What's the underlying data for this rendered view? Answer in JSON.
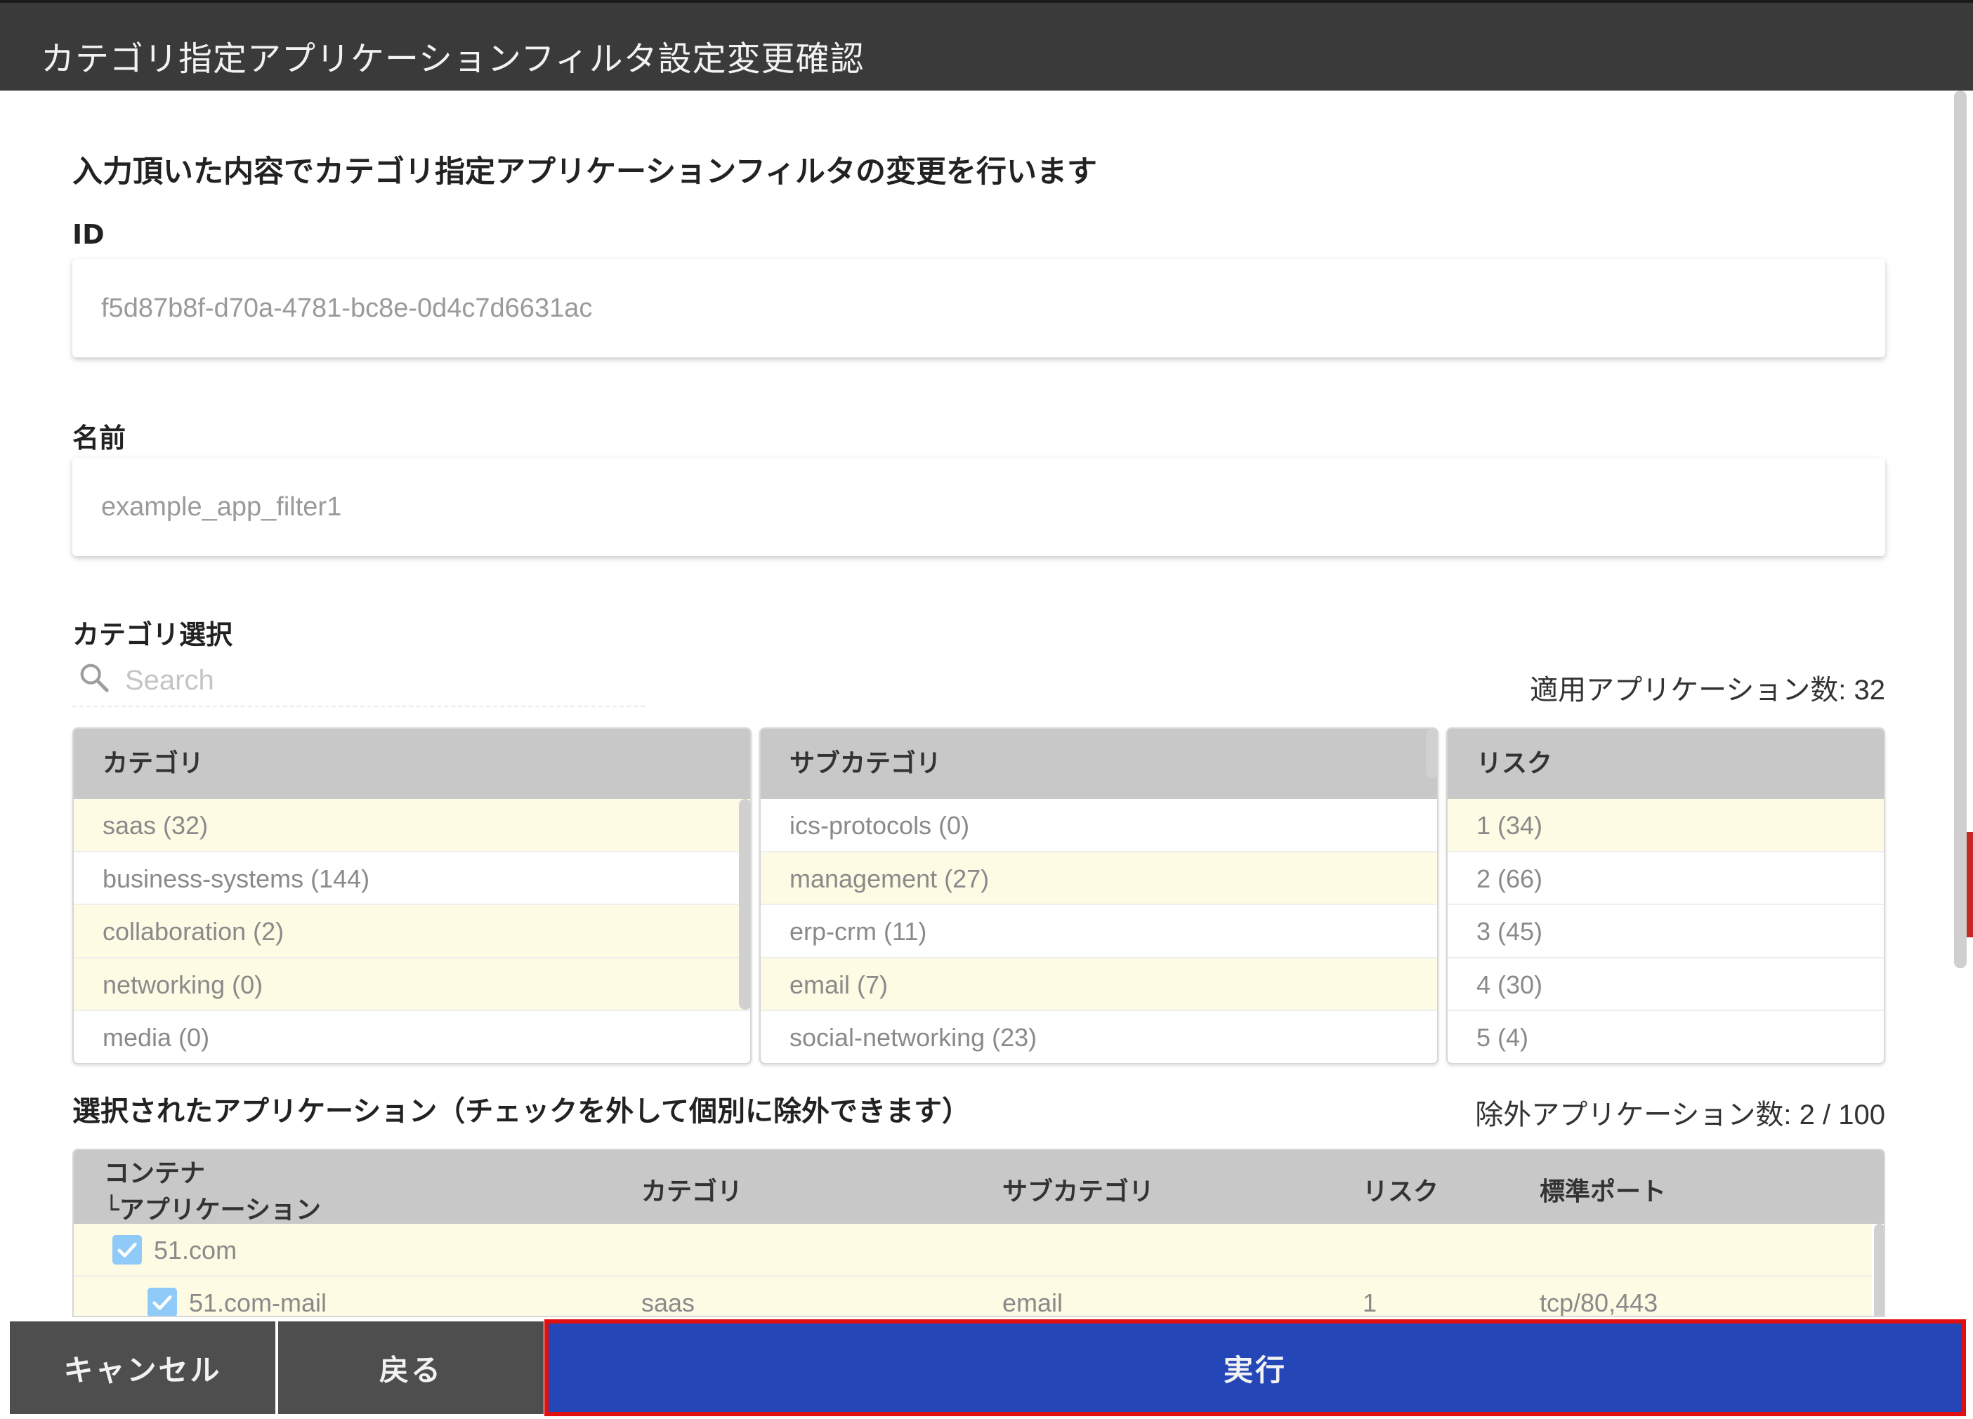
{
  "dialog": {
    "title": "カテゴリ指定アプリケーションフィルタ設定変更確認"
  },
  "lead_text": "入力頂いた内容でカテゴリ指定アプリケーションフィルタの変更を行います",
  "id_field": {
    "label": "ID",
    "value": "f5d87b8f-d70a-4781-bc8e-0d4c7d6631ac"
  },
  "name_field": {
    "label": "名前",
    "value": "example_app_filter1"
  },
  "category_select": {
    "label": "カテゴリ選択",
    "search_placeholder": "Search",
    "applied_count": "適用アプリケーション数: 32",
    "categories": {
      "header": "カテゴリ",
      "items": [
        {
          "label": "saas (32)",
          "selected": true
        },
        {
          "label": "business-systems (144)",
          "selected": false
        },
        {
          "label": "collaboration (2)",
          "selected": true
        },
        {
          "label": "networking (0)",
          "selected": true
        },
        {
          "label": "media (0)",
          "selected": false
        }
      ]
    },
    "subcategories": {
      "header": "サブカテゴリ",
      "items": [
        {
          "label": "ics-protocols (0)",
          "selected": false
        },
        {
          "label": "management (27)",
          "selected": true
        },
        {
          "label": "erp-crm (11)",
          "selected": false
        },
        {
          "label": "email (7)",
          "selected": true
        },
        {
          "label": "social-networking (23)",
          "selected": false
        }
      ]
    },
    "risks": {
      "header": "リスク",
      "items": [
        {
          "label": "1 (34)",
          "selected": true
        },
        {
          "label": "2 (66)",
          "selected": false
        },
        {
          "label": "3 (45)",
          "selected": false
        },
        {
          "label": "4 (30)",
          "selected": false
        },
        {
          "label": "5 (4)",
          "selected": false
        }
      ]
    }
  },
  "selected_apps": {
    "title": "選択されたアプリケーション（チェックを外して個別に除外できます）",
    "excluded_count": "除外アプリケーション数: 2 / 100",
    "columns": {
      "container_line1": "コンテナ",
      "container_line2": "└アプリケーション",
      "category": "カテゴリ",
      "subcategory": "サブカテゴリ",
      "risk": "リスク",
      "port": "標準ポート"
    },
    "rows": [
      {
        "name": "51.com",
        "checked": true,
        "category": "",
        "subcategory": "",
        "risk": "",
        "port": ""
      },
      {
        "name": "51.com-mail",
        "checked": true,
        "category": "saas",
        "subcategory": "email",
        "risk": "1",
        "port": "tcp/80,443"
      }
    ]
  },
  "footer": {
    "cancel": "キャンセル",
    "back": "戻る",
    "run": "実行"
  },
  "colors": {
    "titlebar": "#3a3a3a",
    "selected_row": "#fdfbe4",
    "primary": "#2546b7",
    "highlight": "#e01010"
  }
}
